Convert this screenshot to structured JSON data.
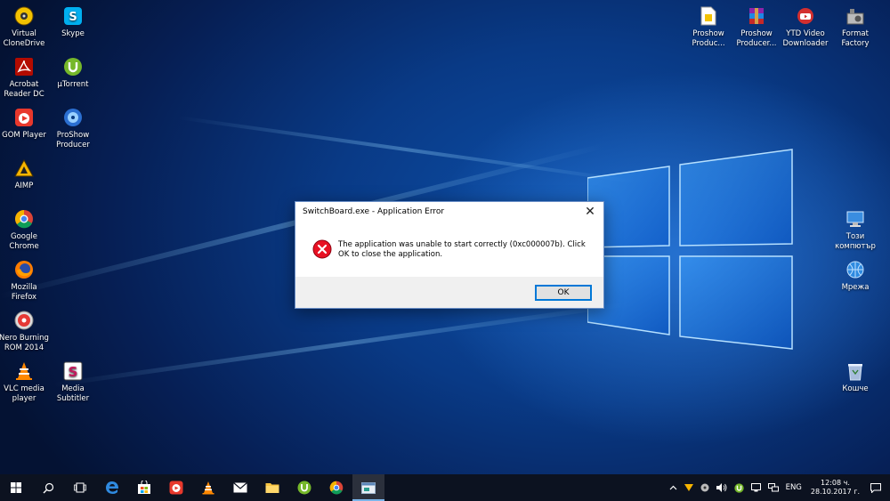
{
  "desktop_icons": {
    "virtual_clonedrive": "Virtual\nCloneDrive",
    "skype": "Skype",
    "acrobat": "Acrobat\nReader DC",
    "utorrent": "µTorrent",
    "gom_player": "GOM Player",
    "proshow_producer_left": "ProShow\nProducer",
    "aimp": "AIMP",
    "google_chrome": "Google\nChrome",
    "mozilla_firefox": "Mozilla\nFirefox",
    "nero": "Nero Burning\nROM 2014",
    "vlc": "VLC media\nplayer",
    "media_subtitler": "Media\nSubtitler",
    "proshow_producer_1": "Proshow\nProduc...",
    "proshow_producer_2": "Proshow\nProducer...",
    "ytd_downloader": "YTD Video\nDownloader",
    "format_factory": "Format\nFactory",
    "this_pc": "Този\nкомпютър",
    "network": "Мрежа",
    "recycle_bin": "Кошче"
  },
  "dialog": {
    "title": "SwitchBoard.exe - Application Error",
    "close_glyph": "✕",
    "message": "The application was unable to start correctly (0xc000007b). Click OK to close the application.",
    "ok_label": "OK"
  },
  "taskbar": {
    "language": "ENG",
    "time": "12:08 ч.",
    "date": "28.10.2017 г."
  },
  "colors": {
    "desktop_blue": "#093a86",
    "taskbar_bg": "#0c1220",
    "accent": "#0078d7",
    "error_red": "#e81123"
  }
}
